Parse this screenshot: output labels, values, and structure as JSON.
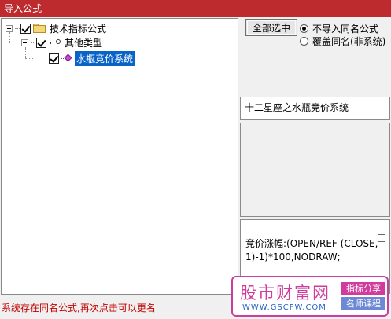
{
  "window": {
    "title": "导入公式"
  },
  "tree": {
    "root": {
      "label": "技术指标公式",
      "checked": true,
      "icon": "folder-icon"
    },
    "group": {
      "label": "其他类型",
      "checked": true,
      "icon": "key-icon"
    },
    "item": {
      "label": "水瓶竞价系统",
      "checked": true,
      "selected": true,
      "icon": "diamond-icon"
    }
  },
  "controls": {
    "select_all_label": "全部选中",
    "radio_options": [
      {
        "label": "不导入同名公式",
        "checked": true
      },
      {
        "label": "覆盖同名(非系统)",
        "checked": false
      }
    ]
  },
  "formula": {
    "name": "十二星座之水瓶竞价系统",
    "code": "竞价涨幅:(OPEN/REF (CLOSE,1)-1)*100,NODRAW;"
  },
  "status": {
    "message": "系统存在同名公式,再次点击可以更名"
  },
  "watermark": {
    "logo": "股市财富网",
    "url": "WWW.GSCFW.COM",
    "tag1": "指标分享",
    "tag2": "名师课程"
  },
  "colors": {
    "titlebar": "#bd2b2f",
    "selection": "#0a64c8",
    "status_text": "#c00000",
    "watermark_accent": "#d13b9b"
  }
}
